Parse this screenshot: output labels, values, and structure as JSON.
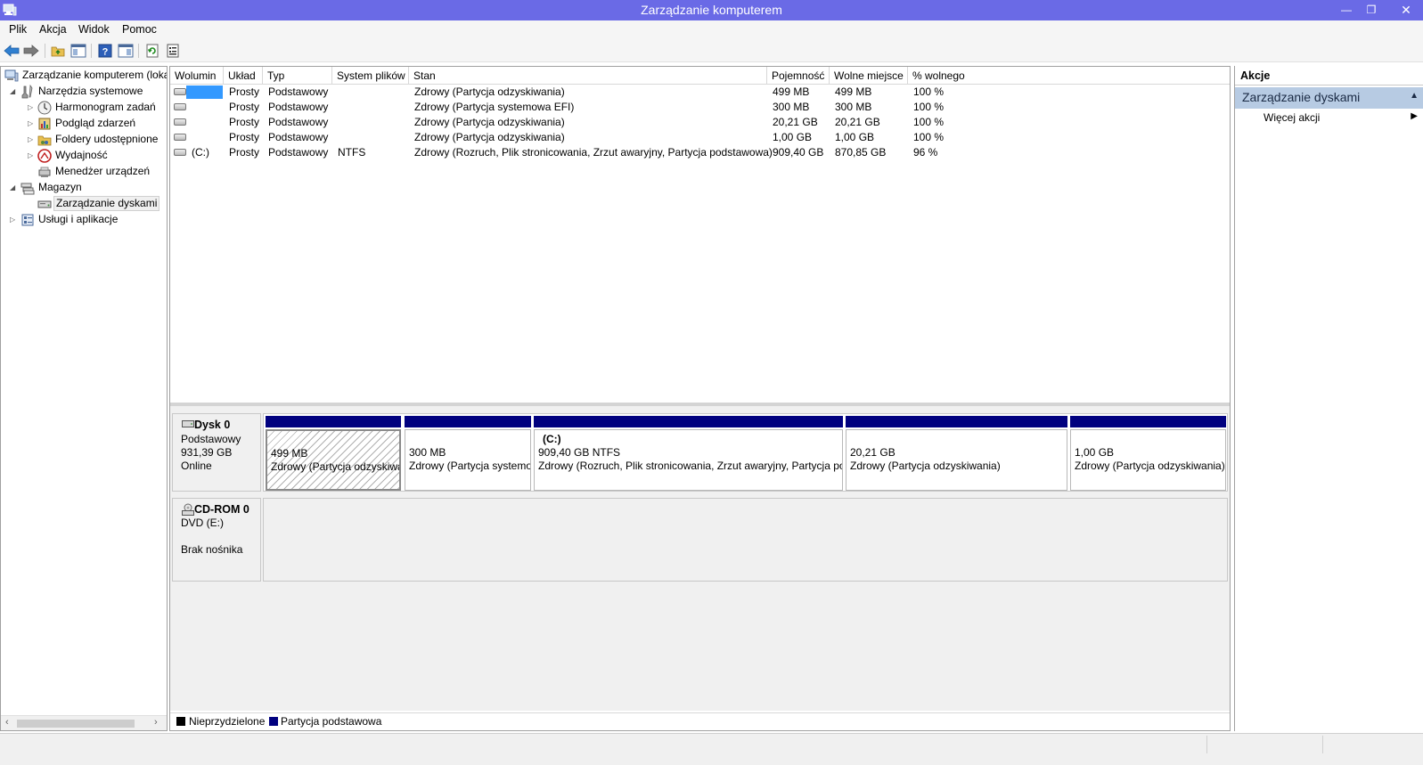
{
  "window": {
    "title": "Zarządzanie komputerem"
  },
  "menu": {
    "items": [
      "Plik",
      "Akcja",
      "Widok",
      "Pomoc"
    ]
  },
  "toolbar": {
    "icons": [
      "back-icon",
      "forward-icon",
      "up-folder-icon",
      "show-hide-tree-icon",
      "help-icon",
      "show-hide-action-pane-icon",
      "refresh-icon",
      "properties-icon"
    ]
  },
  "tree": {
    "root": "Zarządzanie komputerem (loka",
    "system_tools": "Narzędzia systemowe",
    "task_scheduler": "Harmonogram zadań",
    "event_viewer": "Podgląd zdarzeń",
    "shared_folders": "Foldery udostępnione",
    "performance": "Wydajność",
    "device_manager": "Menedżer urządzeń",
    "storage": "Magazyn",
    "disk_management": "Zarządzanie dyskami",
    "services_apps": "Usługi i aplikacje"
  },
  "volumes": {
    "columns": [
      "Wolumin",
      "Układ",
      "Typ",
      "System plików",
      "Stan",
      "Pojemność",
      "Wolne miejsce",
      "% wolnego"
    ],
    "rows": [
      {
        "volume": "",
        "layout": "Prosty",
        "type": "Podstawowy",
        "fs": "",
        "status": "Zdrowy (Partycja odzyskiwania)",
        "capacity": "499 MB",
        "free": "499 MB",
        "pct": "100 %"
      },
      {
        "volume": "",
        "layout": "Prosty",
        "type": "Podstawowy",
        "fs": "",
        "status": "Zdrowy (Partycja systemowa EFI)",
        "capacity": "300 MB",
        "free": "300 MB",
        "pct": "100 %"
      },
      {
        "volume": "",
        "layout": "Prosty",
        "type": "Podstawowy",
        "fs": "",
        "status": "Zdrowy (Partycja odzyskiwania)",
        "capacity": "20,21 GB",
        "free": "20,21 GB",
        "pct": "100 %"
      },
      {
        "volume": "",
        "layout": "Prosty",
        "type": "Podstawowy",
        "fs": "",
        "status": "Zdrowy (Partycja odzyskiwania)",
        "capacity": "1,00 GB",
        "free": "1,00 GB",
        "pct": "100 %"
      },
      {
        "volume": "(C:)",
        "layout": "Prosty",
        "type": "Podstawowy",
        "fs": "NTFS",
        "status": "Zdrowy (Rozruch, Plik stronicowania, Zrzut awaryjny, Partycja podstawowa)",
        "capacity": "909,40 GB",
        "free": "870,85 GB",
        "pct": "96 %"
      }
    ]
  },
  "disk0": {
    "name": "Dysk 0",
    "type": "Podstawowy",
    "size": "931,39 GB",
    "state": "Online",
    "partitions": [
      {
        "title": "",
        "size": "499 MB",
        "status": "Zdrowy (Partycja odzyskiwania)"
      },
      {
        "title": "",
        "size": "300 MB",
        "status": "Zdrowy (Partycja systemowa EFI)"
      },
      {
        "title": "(C:)",
        "size": "909,40 GB NTFS",
        "status": "Zdrowy (Rozruch, Plik stronicowania, Zrzut awaryjny, Partycja podstawowa)"
      },
      {
        "title": "",
        "size": "20,21 GB",
        "status": "Zdrowy (Partycja odzyskiwania)"
      },
      {
        "title": "",
        "size": "1,00 GB",
        "status": "Zdrowy (Partycja odzyskiwania)"
      }
    ]
  },
  "cdrom0": {
    "name": "CD-ROM 0",
    "drive": "DVD (E:)",
    "media": "Brak nośnika"
  },
  "legend": {
    "unallocated": "Nieprzydzielone",
    "primary": "Partycja podstawowa",
    "unallocated_color": "#000000",
    "primary_color": "#00007f"
  },
  "actions": {
    "header": "Akcje",
    "section": "Zarządzanie dyskami",
    "more": "Więcej akcji"
  }
}
